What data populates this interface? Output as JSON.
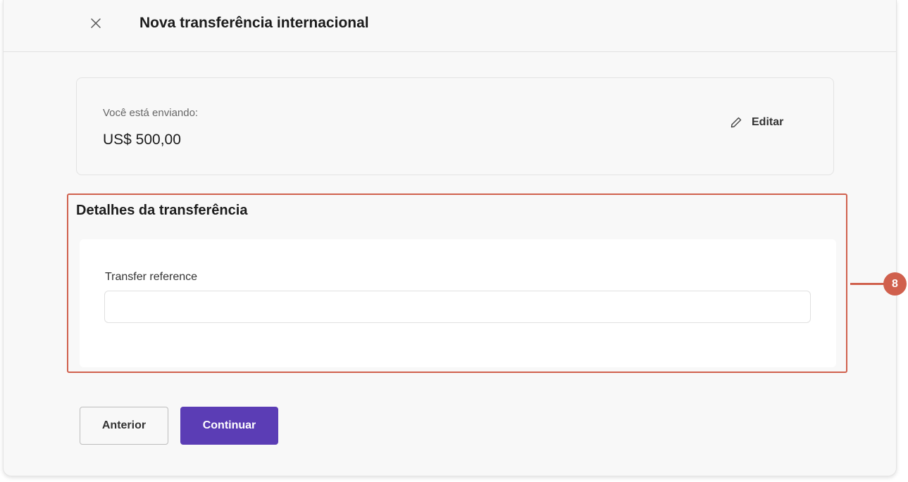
{
  "header": {
    "title": "Nova transferência internacional",
    "close_icon": "close-icon"
  },
  "summary": {
    "label": "Você está enviando:",
    "amount": "US$ 500,00",
    "edit_label": "Editar",
    "edit_icon": "pencil-icon"
  },
  "details": {
    "title": "Detalhes da transferência",
    "field_label": "Transfer reference",
    "field_value": "",
    "field_placeholder": ""
  },
  "callout": {
    "number": "8",
    "color": "#d0604d"
  },
  "footer": {
    "back_label": "Anterior",
    "continue_label": "Continuar",
    "primary_color": "#5b3db5"
  }
}
